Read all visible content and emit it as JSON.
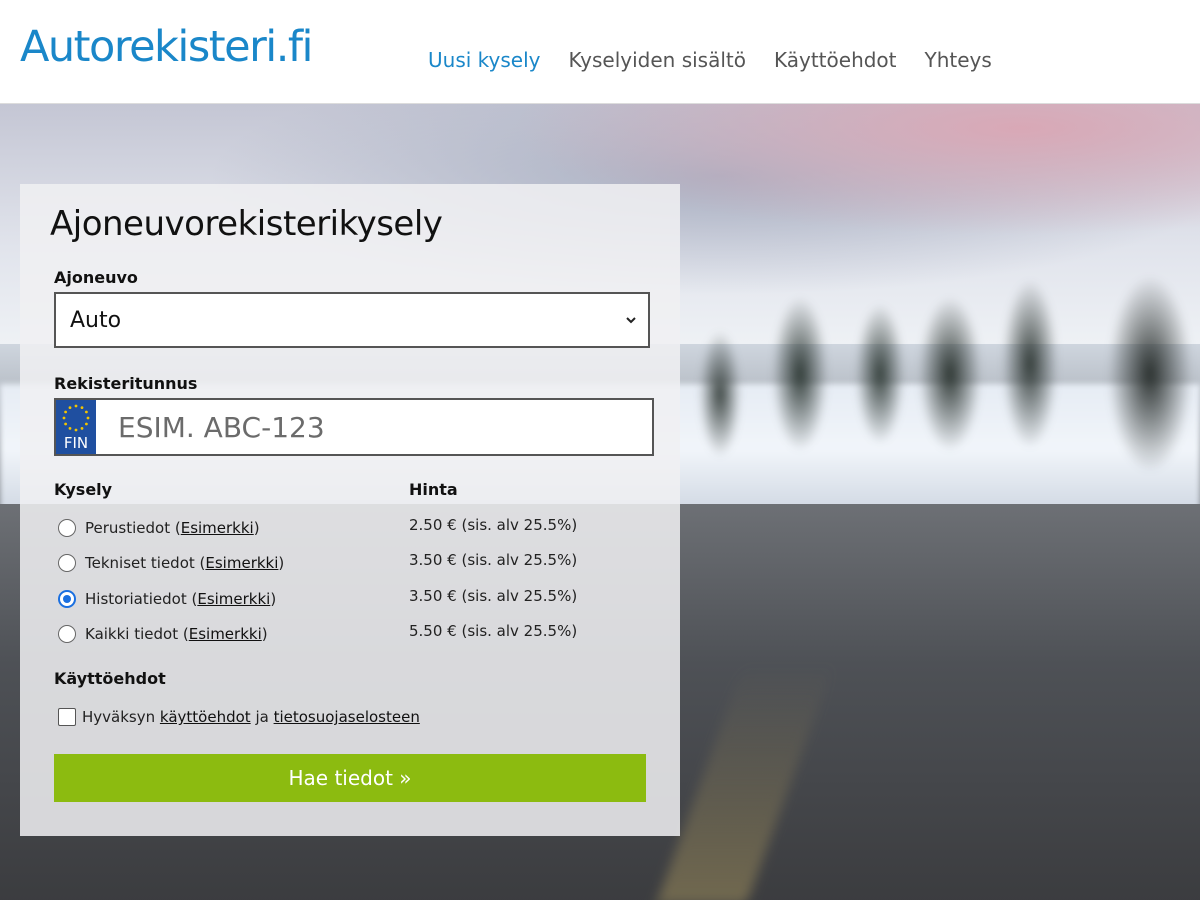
{
  "header": {
    "logo": "Autorekisteri.fi",
    "nav": [
      "Uusi kysely",
      "Kyselyiden sisältö",
      "Käyttöehdot",
      "Yhteys"
    ]
  },
  "form": {
    "title": "Ajoneuvorekisterikysely",
    "vehicle_label": "Ajoneuvo",
    "vehicle_value": "Auto",
    "reg_label": "Rekisteritunnus",
    "plate_country": "FIN",
    "reg_placeholder": "ESIM. ABC-123",
    "query_label": "Kysely",
    "price_label": "Hinta",
    "example_label": "Esimerkki",
    "options": [
      {
        "label": "Perustiedot",
        "price": "2.50 € (sis. alv 25.5%)",
        "selected": false
      },
      {
        "label": "Tekniset tiedot",
        "price": "3.50 € (sis. alv 25.5%)",
        "selected": false
      },
      {
        "label": "Historiatiedot",
        "price": "3.50 € (sis. alv 25.5%)",
        "selected": true
      },
      {
        "label": "Kaikki tiedot",
        "price": "5.50 € (sis. alv 25.5%)",
        "selected": false
      }
    ],
    "terms_label": "Käyttöehdot",
    "terms_prefix": "Hyväksyn",
    "terms_link": "käyttöehdot",
    "terms_and": "ja",
    "privacy_link": "tietosuojaselosteen",
    "submit_label": "Hae tiedot »"
  },
  "colors": {
    "brand": "#1a87c9",
    "submit": "#8cbb10",
    "eu_blue": "#1f4fa0"
  }
}
